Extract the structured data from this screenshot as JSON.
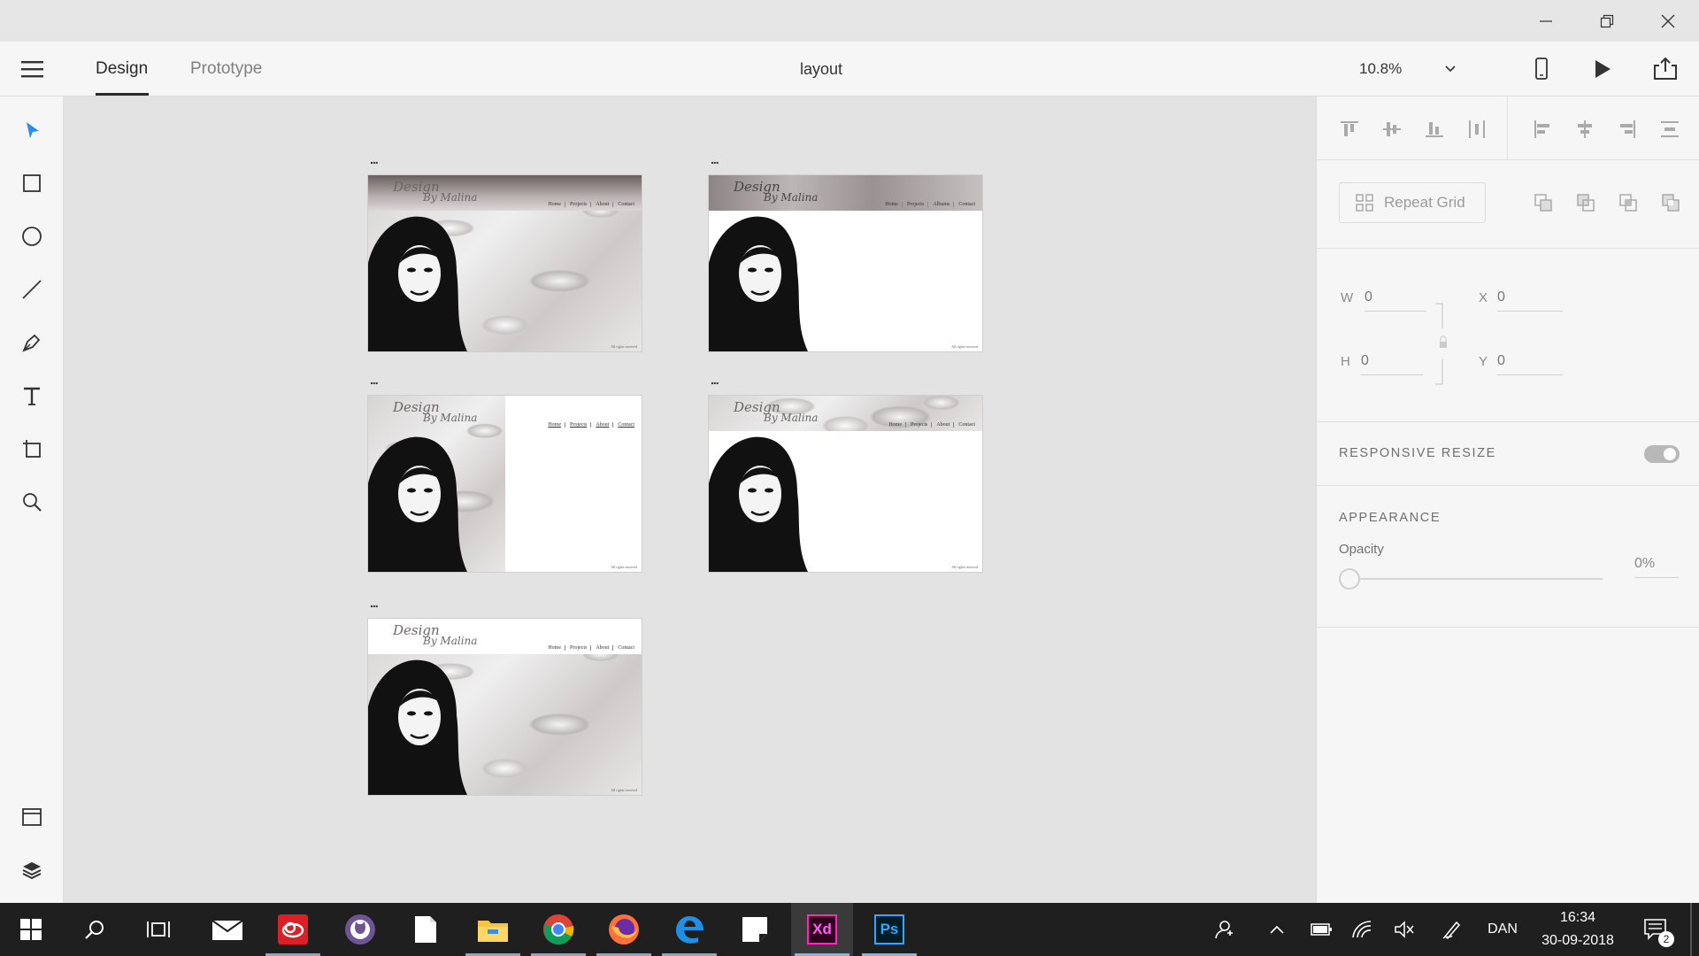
{
  "window": {
    "controls": [
      "minimize-icon",
      "restore-icon",
      "close-icon"
    ]
  },
  "menubar": {
    "tabs": [
      {
        "label": "Design",
        "active": true
      },
      {
        "label": "Prototype",
        "active": false
      }
    ],
    "doc_title": "layout",
    "zoom": "10.8%"
  },
  "toolbar": {
    "tools": [
      "select-arrow-icon",
      "rectangle-icon",
      "ellipse-icon",
      "line-icon",
      "pen-icon",
      "text-icon",
      "artboard-icon",
      "zoom-icon"
    ],
    "bottom": [
      "assets-icon",
      "layers-icon"
    ],
    "accent": "#2d8ceb"
  },
  "canvas": {
    "artboards": [
      {
        "dots": "...",
        "logo_line1": "Design",
        "logo_line2": "By Malina",
        "nav": [
          "Home",
          "Projects",
          "About",
          "Contact"
        ],
        "footer": "All rights reserved",
        "variant": "full-marble"
      },
      {
        "dots": "...",
        "logo_line1": "Design",
        "logo_line2": "By Malina",
        "nav": [
          "Home",
          "Projects",
          "Albums",
          "Contact"
        ],
        "footer": "All rights reserved",
        "variant": "dark-header"
      },
      {
        "dots": "...",
        "logo_line1": "Design",
        "logo_line2": "By Malina",
        "nav": [
          "Home",
          "Projects",
          "About",
          "Contact"
        ],
        "footer": "All rights reserved",
        "variant": "left-marble"
      },
      {
        "dots": "...",
        "logo_line1": "Design",
        "logo_line2": "By Malina",
        "nav": [
          "Home",
          "Projects",
          "About",
          "Contact"
        ],
        "footer": "All rights reserved",
        "variant": "marble-header"
      },
      {
        "dots": "...",
        "logo_line1": "Design",
        "logo_line2": "By Malina",
        "nav": [
          "Home",
          "Projects",
          "About",
          "Contact"
        ],
        "footer": "All rights reserved",
        "variant": "full-marble-white-header"
      }
    ]
  },
  "panel": {
    "repeat_grid": "Repeat Grid",
    "w_label": "W",
    "w_value": "0",
    "x_label": "X",
    "x_value": "0",
    "h_label": "H",
    "h_value": "0",
    "y_label": "Y",
    "y_value": "0",
    "responsive_resize": "RESPONSIVE RESIZE",
    "responsive_on": true,
    "appearance": "APPEARANCE",
    "opacity_label": "Opacity",
    "opacity_value": "0%"
  },
  "taskbar": {
    "apps": [
      "start-icon",
      "search-icon",
      "task-view-icon",
      "mail-icon",
      "creative-cloud-icon",
      "github-icon",
      "notepad-icon",
      "file-explorer-icon",
      "chrome-icon",
      "firefox-icon",
      "edge-icon",
      "sticky-notes-icon",
      "xd-icon",
      "photoshop-icon"
    ],
    "xd_label": "Xd",
    "ps_label": "Ps",
    "lang": "DAN",
    "time": "16:34",
    "date": "30-09-2018",
    "notifications": "2"
  }
}
